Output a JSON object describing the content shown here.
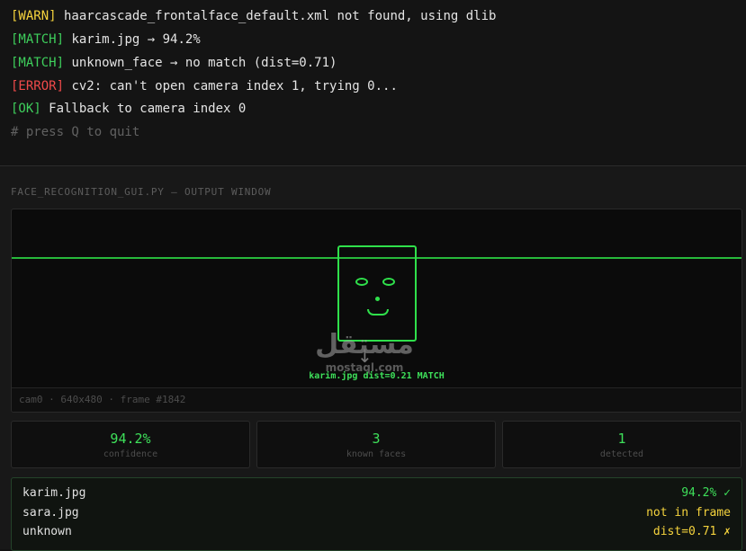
{
  "log": {
    "lines": [
      {
        "tag": "[WARN]",
        "text": " haarcascade_frontalface_default.xml not found, using dlib"
      },
      {
        "tag": "[MATCH]",
        "text": " karim.jpg → 94.2%"
      },
      {
        "tag": "[MATCH]",
        "text": " unknown_face → no match (dist=0.71)"
      },
      {
        "tag": "[ERROR]",
        "text": " cv2: can't open camera index 1, trying 0..."
      },
      {
        "tag": "[OK]",
        "text": " Fallback to camera index 0"
      }
    ],
    "hint": "# press Q to quit"
  },
  "window": {
    "title": "FACE_RECOGNITION_GUI.PY — OUTPUT WINDOW",
    "caption": "karim.jpg dist=0.21 MATCH",
    "footer": "cam0 · 640x480 · frame #1842"
  },
  "stats": [
    {
      "value": "94.2%",
      "label": "confidence"
    },
    {
      "value": "3",
      "label": "known faces"
    },
    {
      "value": "1",
      "label": "detected"
    }
  ],
  "results": [
    {
      "name": "karim.jpg",
      "status": "94.2% ✓"
    },
    {
      "name": "sara.jpg",
      "status": "not in frame"
    },
    {
      "name": "unknown",
      "status": "dist=0.71 ✗"
    }
  ],
  "watermark": {
    "arabic": "مستقل",
    "latin": "mostaql.com",
    "icon": "download-arrow-icon"
  },
  "colors": {
    "accent_green": "#3ee05a",
    "warn_yellow": "#f5d33d",
    "error_red": "#ef4a4a",
    "background": "#131313"
  }
}
